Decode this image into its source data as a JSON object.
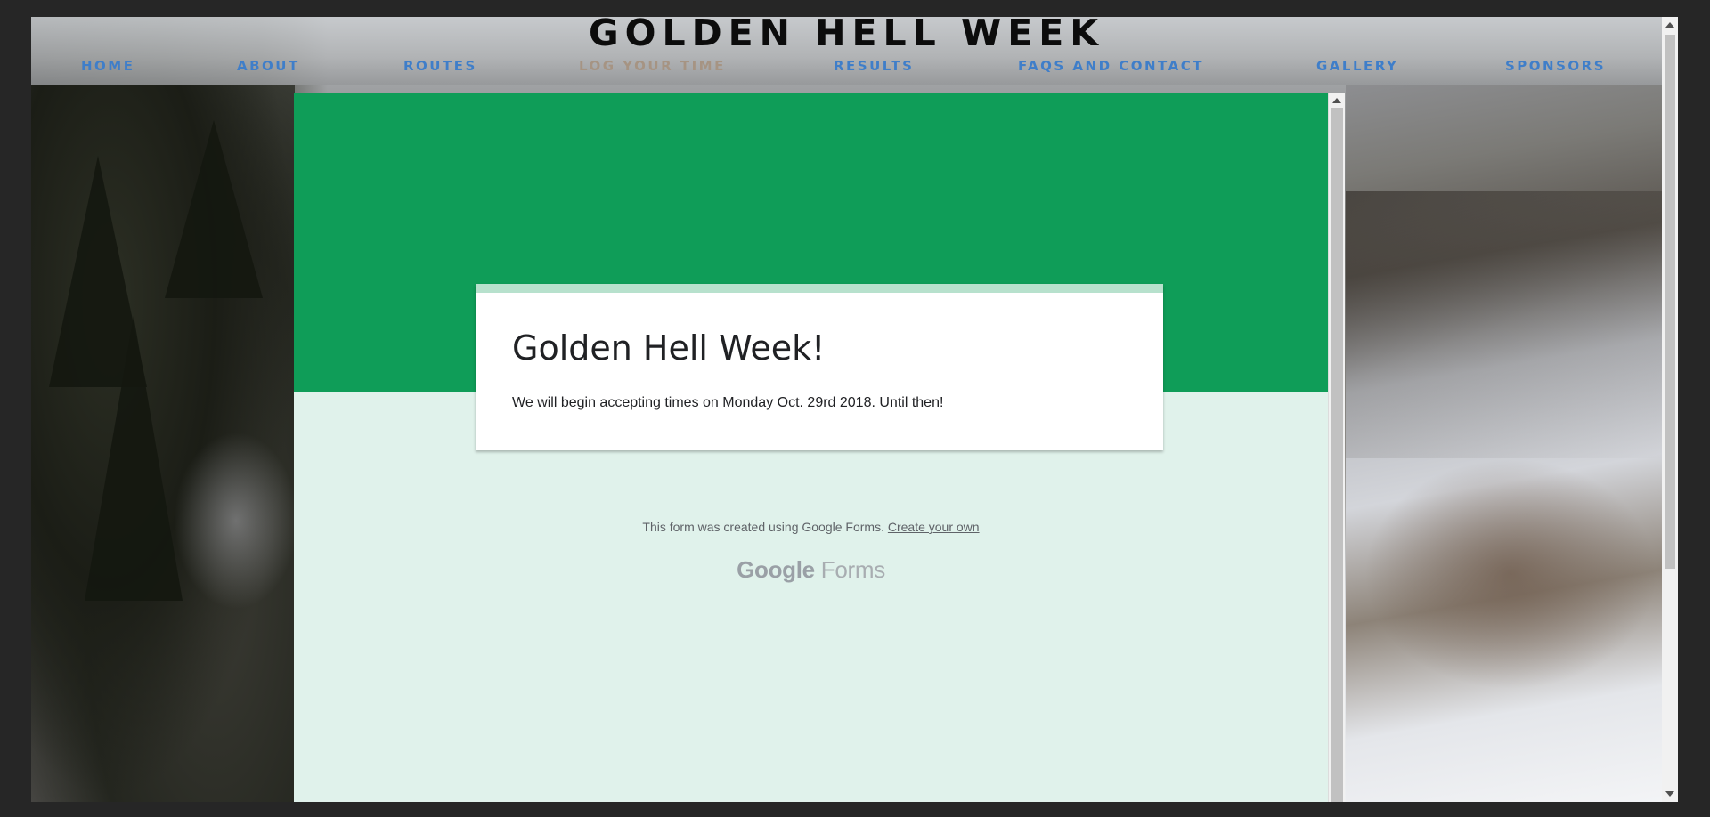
{
  "site": {
    "title": "GOLDEN HELL WEEK"
  },
  "nav": {
    "items": [
      {
        "label": "HOME",
        "active": false
      },
      {
        "label": "ABOUT",
        "active": false
      },
      {
        "label": "ROUTES",
        "active": false
      },
      {
        "label": "LOG YOUR TIME",
        "active": true
      },
      {
        "label": "RESULTS",
        "active": false
      },
      {
        "label": "FAQS AND CONTACT",
        "active": false
      },
      {
        "label": "GALLERY",
        "active": false
      },
      {
        "label": "SPONSORS",
        "active": false
      }
    ]
  },
  "form": {
    "banner_color": "#0f9d58",
    "accent_color": "#b7e1cd",
    "title": "Golden Hell Week!",
    "description": "We will begin accepting times on Monday Oct. 29rd 2018. Until then!",
    "footer_text": "This form was created using Google Forms.",
    "footer_link": "Create your own",
    "brand_google": "Google",
    "brand_forms": "Forms"
  }
}
